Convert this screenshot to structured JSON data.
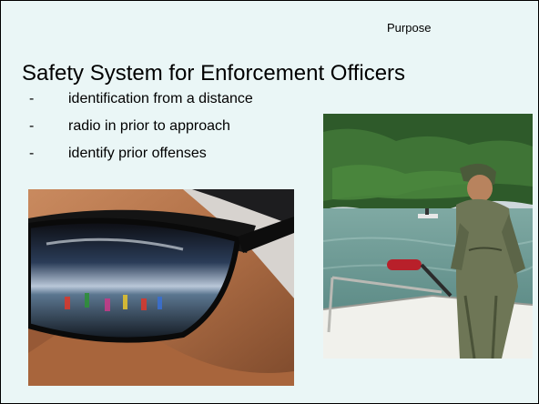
{
  "slide": {
    "header_label": "Purpose",
    "title": "Safety System for Enforcement Officers",
    "bullets": [
      {
        "marker": "-",
        "text": "identification from a distance"
      },
      {
        "marker": "-",
        "text": "radio in prior to approach"
      },
      {
        "marker": "-",
        "text": "identify prior offenses"
      }
    ]
  },
  "images": {
    "left_icon": "sunglasses-reflection-photo",
    "right_icon": "officer-on-boat-photo"
  },
  "colors": {
    "slide_background": "#eaf6f6",
    "border": "#000000"
  }
}
